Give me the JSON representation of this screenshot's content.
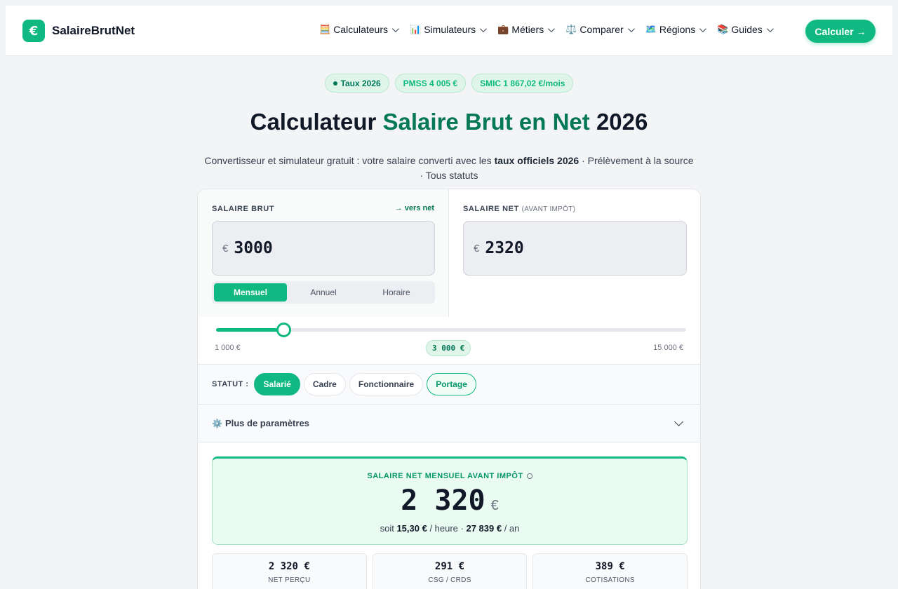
{
  "header": {
    "brand": "SalaireBrutNet",
    "logo_glyph": "€",
    "menu": [
      {
        "icon": "🧮",
        "label": "Calculateurs"
      },
      {
        "icon": "📊",
        "label": "Simulateurs"
      },
      {
        "icon": "💼",
        "label": "Métiers"
      },
      {
        "icon": "⚖️",
        "label": "Comparer"
      },
      {
        "icon": "🗺️",
        "label": "Régions"
      },
      {
        "icon": "📚",
        "label": "Guides"
      }
    ],
    "cta": "Calculer →"
  },
  "badges": [
    "Taux 2026",
    "PMSS 4 005 €",
    "SMIC 1 867,02 €/mois"
  ],
  "hero": {
    "title_part1": "Calculateur ",
    "title_accent": "Salaire Brut en Net",
    "title_part2": " 2026",
    "sub_part1": "Convertisseur et simulateur gratuit : votre salaire converti avec les ",
    "sub_bold": "taux officiels 2026",
    "sub_part2": " · Prélèvement à la source · Tous statuts"
  },
  "brut": {
    "label": "SALAIRE BRUT",
    "link": "→ vers net",
    "currency": "€",
    "value": "3000",
    "periods": [
      "Mensuel",
      "Annuel",
      "Horaire"
    ],
    "active_period": "Mensuel"
  },
  "net": {
    "label": "SALAIRE NET",
    "label_small": "(AVANT IMPÔT)",
    "currency": "€",
    "value": "2320"
  },
  "slider": {
    "min_label": "1 000 €",
    "max_label": "15 000 €",
    "current_label": "3 000 €",
    "min": 1000,
    "max": 15000,
    "value": 3000
  },
  "statut": {
    "label": "STATUT :",
    "options": [
      "Salarié",
      "Cadre",
      "Fonctionnaire",
      "Portage"
    ],
    "active": "Salarié"
  },
  "params": {
    "icon": "⚙️",
    "label": "Plus de paramètres"
  },
  "result": {
    "label": "SALAIRE NET MENSUEL AVANT IMPÔT",
    "value": "2 320",
    "currency": "€",
    "sub_prefix": "soit ",
    "hourly": "15,30 €",
    "sub_mid": " / heure · ",
    "yearly": "27 839 €",
    "sub_suffix": " / an"
  },
  "stats": [
    {
      "value": "2 320 €",
      "label": "NET PERÇU"
    },
    {
      "value": "291 €",
      "label": "CSG / CRDS"
    },
    {
      "value": "389 €",
      "label": "COTISATIONS"
    }
  ],
  "colors": {
    "accent": "#10b981",
    "accent_dark": "#047857",
    "text": "#111827",
    "background": "#f3f4f6"
  }
}
